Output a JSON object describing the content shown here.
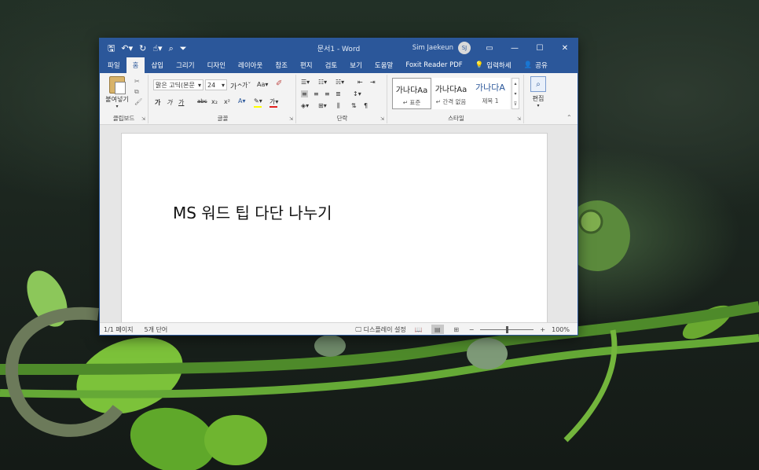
{
  "titlebar": {
    "doc_title": "문서1  -  Word",
    "user_name": "Sim Jaekeun",
    "user_initials": "SJ",
    "qat_icons": [
      "save-icon",
      "undo-icon",
      "redo-icon",
      "touch-mode-icon",
      "print-preview-icon",
      "customize-icon"
    ],
    "controls": [
      "ribbon-display-icon",
      "minimize-icon",
      "maximize-icon",
      "close-icon"
    ]
  },
  "tabs": {
    "items": [
      "파일",
      "홈",
      "삽입",
      "그리기",
      "디자인",
      "레이아웃",
      "참조",
      "편지",
      "검토",
      "보기",
      "도움말",
      "Foxit Reader PDF"
    ],
    "active": "홈",
    "search_label": "입력하세",
    "share_label": "공유"
  },
  "ribbon": {
    "clipboard": {
      "paste_label": "붙여넣기",
      "group_label": "클립보드"
    },
    "font": {
      "font_name": "맑은 고딕(본문",
      "font_size": "24",
      "group_label": "글꼴",
      "bold": "가",
      "italic": "가",
      "underline": "가",
      "strike": "abc",
      "subscript": "x₂",
      "superscript": "x²",
      "grow": "가",
      "shrink": "가",
      "change_case": "Aa",
      "font_color_letter": "가"
    },
    "paragraph": {
      "group_label": "단락"
    },
    "styles": {
      "group_label": "스타일",
      "items": [
        {
          "sample": "가나다Aa",
          "name": "↵ 표준"
        },
        {
          "sample": "가나다Aa",
          "name": "↵ 간격 없음"
        },
        {
          "sample": "가나다A",
          "name": "제목 1"
        }
      ]
    },
    "editing": {
      "label": "편집"
    }
  },
  "document": {
    "text": "MS 워드 팁 다단 나누기"
  },
  "statusbar": {
    "page": "1/1 페이지",
    "words": "5개 단어",
    "display_settings": "디스플레이 설정",
    "zoom": "100%",
    "zoom_minus": "−",
    "zoom_plus": "+"
  },
  "colors": {
    "word_blue": "#2b579a",
    "ribbon_bg": "#f3f3f3",
    "font_color_bar": "#e0201e",
    "highlight_bar": "#ffff00"
  }
}
